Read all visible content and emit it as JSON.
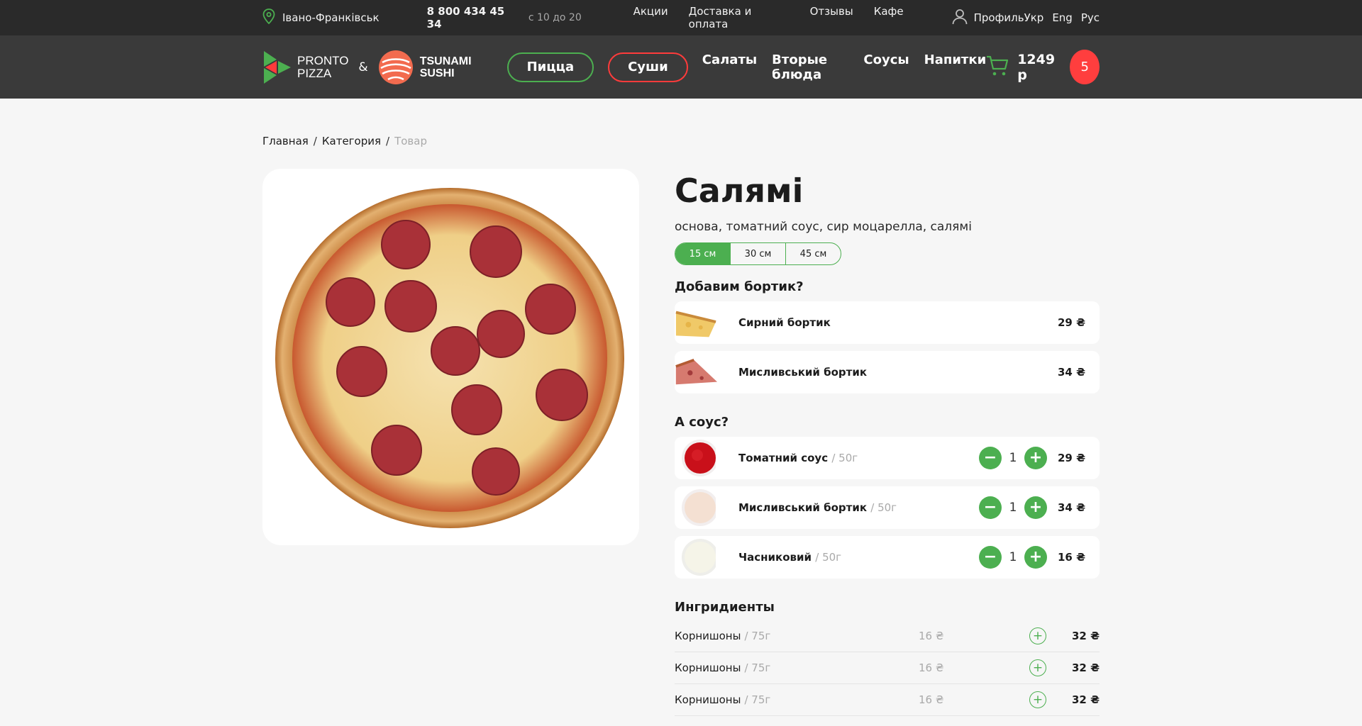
{
  "topbar": {
    "city": "Івано-Франківськ",
    "phone": "8 800 434 45 34",
    "hours": "с 10 до 20",
    "links": [
      "Акции",
      "Доставка и оплата",
      "Отзывы",
      "Кафе"
    ],
    "profile": "Профиль",
    "languages": [
      "Укр",
      "Eng",
      "Рус"
    ]
  },
  "nav": {
    "logo_pronto_line1": "PRONTO",
    "logo_pronto_line2": "PIZZA",
    "logo_amp": "&",
    "logo_sushi_line1": "TSUNAMI",
    "logo_sushi_line2": "SUSHI",
    "pill_pizza": "Пицца",
    "pill_sushi": "Суши",
    "links": [
      "Салаты",
      "Вторые блюда",
      "Соусы",
      "Напитки"
    ],
    "cart_total": "1249 р",
    "cart_count": "5"
  },
  "breadcrumb": [
    "Главная",
    "Категория",
    "Товар"
  ],
  "product": {
    "title": "Салямі",
    "description": "основа, томатний соус, сир моцарелла, салямі",
    "sizes": [
      "15 см",
      "30 см",
      "45 см"
    ]
  },
  "crust": {
    "title": "Добавим бортик?",
    "items": [
      {
        "name": "Сирний бортик",
        "price": "29 ₴"
      },
      {
        "name": "Мисливський бортик",
        "price": "34 ₴"
      }
    ]
  },
  "sauce": {
    "title": "А соус?",
    "items": [
      {
        "name": "Томатний соус",
        "weight": "/ 50г",
        "qty": "1",
        "price": "29 ₴"
      },
      {
        "name": "Мисливський бортик",
        "weight": "/ 50г",
        "qty": "1",
        "price": "34 ₴"
      },
      {
        "name": "Часниковий",
        "weight": "/ 50г",
        "qty": "1",
        "price": "16 ₴"
      }
    ]
  },
  "ingredients": {
    "title": "Ингридиенты",
    "items": [
      {
        "name": "Корнишоны",
        "weight": "/ 75г",
        "price_old": "16 ₴",
        "price": "32 ₴"
      },
      {
        "name": "Корнишоны",
        "weight": "/ 75г",
        "price_old": "16 ₴",
        "price": "32 ₴"
      },
      {
        "name": "Корнишоны",
        "weight": "/ 75г",
        "price_old": "16 ₴",
        "price": "32 ₴"
      }
    ]
  },
  "colors": {
    "accent_green": "#4caf50",
    "accent_red": "#ff3b3b",
    "topbar_bg": "#2a2a2a",
    "nav_bg": "#3a3a3a"
  }
}
